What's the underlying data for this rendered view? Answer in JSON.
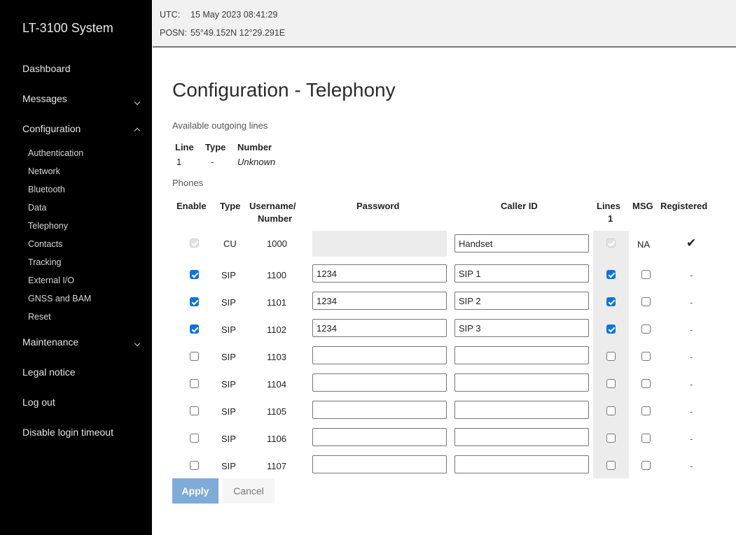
{
  "app": {
    "title": "LT-3100 System"
  },
  "sidebar": {
    "items": [
      {
        "label": "Dashboard"
      },
      {
        "label": "Messages"
      },
      {
        "label": "Configuration"
      },
      {
        "label": "Maintenance"
      },
      {
        "label": "Legal notice"
      },
      {
        "label": "Log out"
      },
      {
        "label": "Disable login timeout"
      }
    ],
    "config_subitems": [
      "Authentication",
      "Network",
      "Bluetooth",
      "Data",
      "Telephony",
      "Contacts",
      "Tracking",
      "External I/O",
      "GNSS and BAM",
      "Reset"
    ]
  },
  "status": {
    "utc_label": "UTC:",
    "utc_value": "15 May 2023 08:41:29",
    "posn_label": "POSN:",
    "posn_value": "55°49.152N 12°29.291E"
  },
  "page": {
    "title": "Configuration - Telephony",
    "outgoing_heading": "Available outgoing lines",
    "outgoing_columns": [
      "Line",
      "Type",
      "Number"
    ],
    "outgoing_rows": [
      {
        "line": "1",
        "type": "-",
        "number": "Unknown"
      }
    ],
    "phones_heading": "Phones",
    "phone_columns": {
      "enable": "Enable",
      "type": "Type",
      "username_1": "Username/",
      "username_2": "Number",
      "password": "Password",
      "caller_id": "Caller ID",
      "lines": "Lines",
      "lines_sub": "1",
      "msg": "MSG",
      "registered": "Registered"
    },
    "phones": [
      {
        "enabled": true,
        "type": "CU",
        "number": "1000",
        "password": "",
        "caller_id": "Handset",
        "line1": true,
        "msg": "NA",
        "registered": "✔"
      },
      {
        "enabled": true,
        "type": "SIP",
        "number": "1100",
        "password": "1234",
        "caller_id": "SIP 1",
        "line1": true,
        "msg": false,
        "registered": "-"
      },
      {
        "enabled": true,
        "type": "SIP",
        "number": "1101",
        "password": "1234",
        "caller_id": "SIP 2",
        "line1": true,
        "msg": false,
        "registered": "-"
      },
      {
        "enabled": true,
        "type": "SIP",
        "number": "1102",
        "password": "1234",
        "caller_id": "SIP 3",
        "line1": true,
        "msg": false,
        "registered": "-"
      },
      {
        "enabled": false,
        "type": "SIP",
        "number": "1103",
        "password": "",
        "caller_id": "",
        "line1": false,
        "msg": false,
        "registered": "-"
      },
      {
        "enabled": false,
        "type": "SIP",
        "number": "1104",
        "password": "",
        "caller_id": "",
        "line1": false,
        "msg": false,
        "registered": "-"
      },
      {
        "enabled": false,
        "type": "SIP",
        "number": "1105",
        "password": "",
        "caller_id": "",
        "line1": false,
        "msg": false,
        "registered": "-"
      },
      {
        "enabled": false,
        "type": "SIP",
        "number": "1106",
        "password": "",
        "caller_id": "",
        "line1": false,
        "msg": false,
        "registered": "-"
      },
      {
        "enabled": false,
        "type": "SIP",
        "number": "1107",
        "password": "",
        "caller_id": "",
        "line1": false,
        "msg": false,
        "registered": "-"
      }
    ],
    "apply_label": "Apply",
    "cancel_label": "Cancel"
  },
  "colors": {
    "sidebar_bg": "#000000",
    "accent": "#0d74d9",
    "apply_bg": "#7fabd9"
  }
}
